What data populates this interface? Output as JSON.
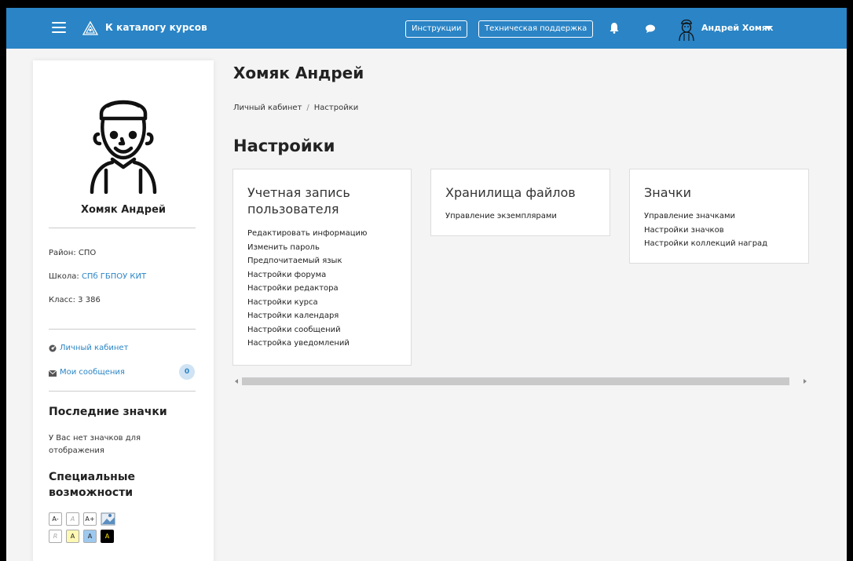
{
  "topbar": {
    "catalog_label": "К каталогу курсов",
    "instructions_label": "Инструкции",
    "support_label": "Техническая поддержка",
    "user_name": "Андрей Хомяк",
    "icons": [
      "menu-icon",
      "logo-icon",
      "bell-icon",
      "chat-icon",
      "user-avatar-icon",
      "caret-down-icon"
    ],
    "color": "#2a84c5"
  },
  "sidebar": {
    "name": "Хомяк Андрей",
    "district_label": "Район:",
    "district_value": "СПО",
    "school_label": "Школа:",
    "school_value": "СПб ГБПОУ КИТ",
    "class_label": "Класс:",
    "class_value": "3 386",
    "nav_dashboard": "Личный кабинет",
    "nav_messages": "Мои сообщения",
    "messages_count": "0",
    "badges_heading": "Последние значки",
    "badges_empty": "У Вас нет значков для отображения",
    "a11y_heading": "Специальные возможности",
    "a11y_buttons_row1": [
      "A-",
      "A",
      "A+"
    ],
    "a11y_buttons_row2": [
      "R",
      "A",
      "A",
      "A"
    ]
  },
  "main": {
    "user_title": "Хомяк Андрей",
    "breadcrumb": [
      "Личный кабинет",
      "Настройки"
    ],
    "breadcrumb_sep": "/",
    "page_title": "Настройки",
    "cards": [
      {
        "title": "Учетная запись пользователя",
        "links": [
          "Редактировать информацию",
          "Изменить пароль",
          "Предпочитаемый язык",
          "Настройки форума",
          "Настройки редактора",
          "Настройки курса",
          "Настройки календаря",
          "Настройки сообщений",
          "Настройка уведомлений"
        ]
      },
      {
        "title": "Хранилища файлов",
        "links": [
          "Управление экземплярами"
        ]
      },
      {
        "title": "Значки",
        "links": [
          "Управление значками",
          "Настройки значков",
          "Настройки коллекций наград"
        ]
      }
    ]
  }
}
